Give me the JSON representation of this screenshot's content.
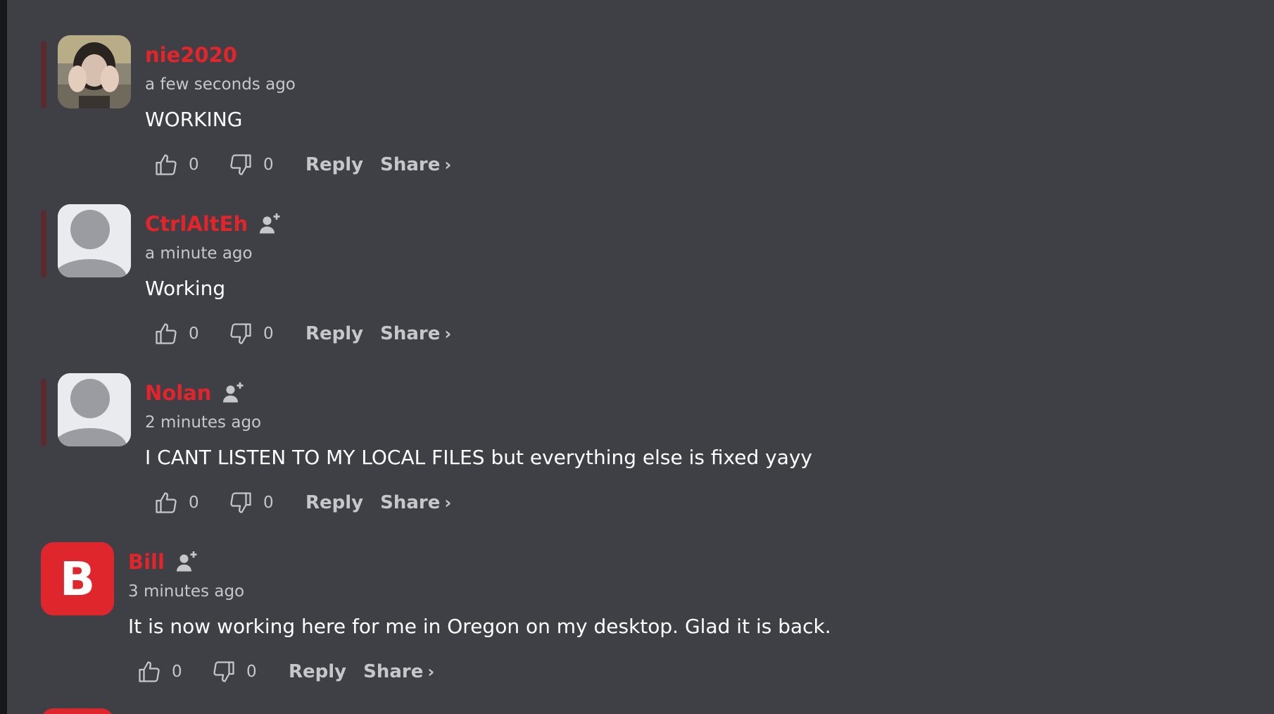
{
  "comments": [
    {
      "username": "nie2020",
      "timestamp": "a few seconds ago",
      "text": "WORKING",
      "likes": "0",
      "dislikes": "0",
      "reply_label": "Reply",
      "share_label": "Share",
      "share_chevron": "›",
      "avatar_type": "photo"
    },
    {
      "username": "CtrlAltEh",
      "timestamp": "a minute ago",
      "text": "Working",
      "likes": "0",
      "dislikes": "0",
      "reply_label": "Reply",
      "share_label": "Share",
      "share_chevron": "›",
      "avatar_type": "default-user"
    },
    {
      "username": "Nolan",
      "timestamp": "2 minutes ago",
      "text": "I CANT LISTEN TO MY LOCAL FILES but everything else is fixed yayy",
      "likes": "0",
      "dislikes": "0",
      "reply_label": "Reply",
      "share_label": "Share",
      "share_chevron": "›",
      "avatar_type": "default-user"
    },
    {
      "username": "Bill",
      "avatar_letter": "B",
      "timestamp": "3 minutes ago",
      "text": "It is now working here for me in Oregon on my desktop. Glad it is back.",
      "likes": "0",
      "dislikes": "0",
      "reply_label": "Reply",
      "share_label": "Share",
      "share_chevron": "›",
      "avatar_type": "letter"
    }
  ],
  "colors": {
    "background": "#3f4046",
    "username": "#e3242b",
    "meta_text": "#c6c7cb",
    "comment_text": "#ffffff",
    "letter_avatar_bg": "#e0262d"
  },
  "icons": [
    "thumbs-up-icon",
    "thumbs-down-icon",
    "follow-user-icon",
    "default-user-avatar-icon"
  ]
}
